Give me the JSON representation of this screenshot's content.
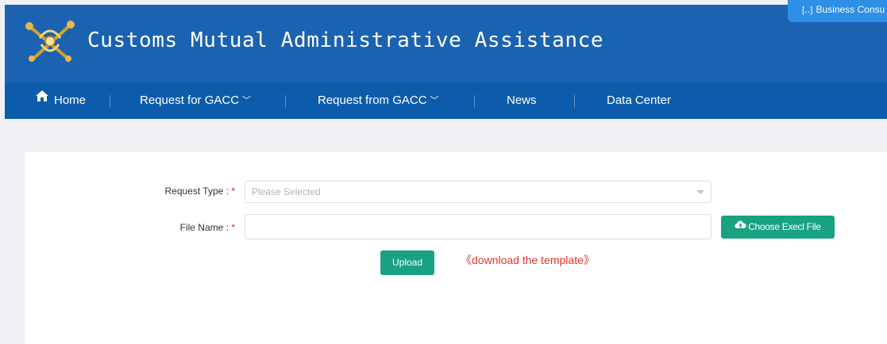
{
  "header": {
    "title": "Customs Mutual Administrative Assistance",
    "logo_icon": "customs-emblem-icon",
    "consult_label": "Business Consu",
    "consult_icon": "chat-icon",
    "bg_color": "#1b63b0"
  },
  "nav": {
    "bg_color": "#0d5cab",
    "items": [
      {
        "label": "Home",
        "icon": "home-icon"
      },
      {
        "label": "Request for GACC",
        "icon": "chevron-down-icon"
      },
      {
        "label": "Request from GACC",
        "icon": "chevron-down-icon"
      },
      {
        "label": "News"
      },
      {
        "label": "Data Center"
      }
    ]
  },
  "form": {
    "request_type": {
      "label": "Request Type :",
      "required_mark": "*",
      "placeholder": "Please Selected"
    },
    "file_name": {
      "label": "File Name :",
      "required_mark": "*",
      "value": ""
    },
    "choose_button": {
      "label": "Choose Execl File",
      "icon": "cloud-upload-icon",
      "color": "#18a282"
    },
    "upload_button": {
      "label": "Upload",
      "color": "#18a282"
    },
    "template_link": {
      "label": "《download the template》",
      "color": "#e8312b"
    }
  }
}
